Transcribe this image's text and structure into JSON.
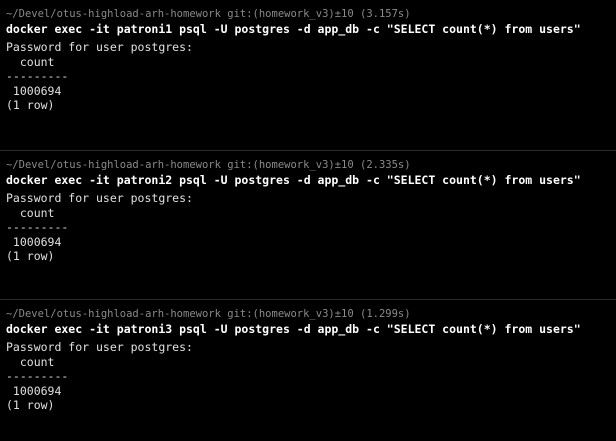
{
  "window": {
    "background": "#000000",
    "prompt_color": "#8a8a8a",
    "command_color": "#ffffff"
  },
  "blocks": [
    {
      "prompt": "~/Devel/otus-highload-arh-homework git:(homework_v3)±10 (3.157s)",
      "command": "docker exec -it patroni1 psql -U postgres -d app_db -c \"SELECT count(*) from users\"",
      "output": [
        "Password for user postgres:",
        "  count",
        "---------",
        " 1000694",
        "(1 row)"
      ]
    },
    {
      "prompt": "~/Devel/otus-highload-arh-homework git:(homework_v3)±10 (2.335s)",
      "command": "docker exec -it patroni2 psql -U postgres -d app_db -c \"SELECT count(*) from users\"",
      "output": [
        "Password for user postgres:",
        "  count",
        "---------",
        " 1000694",
        "(1 row)"
      ]
    },
    {
      "prompt": "~/Devel/otus-highload-arh-homework git:(homework_v3)±10 (1.299s)",
      "command": "docker exec -it patroni3 psql -U postgres -d app_db -c \"SELECT count(*) from users\"",
      "output": [
        "Password for user postgres:",
        "  count",
        "---------",
        " 1000694",
        "(1 row)"
      ]
    }
  ]
}
